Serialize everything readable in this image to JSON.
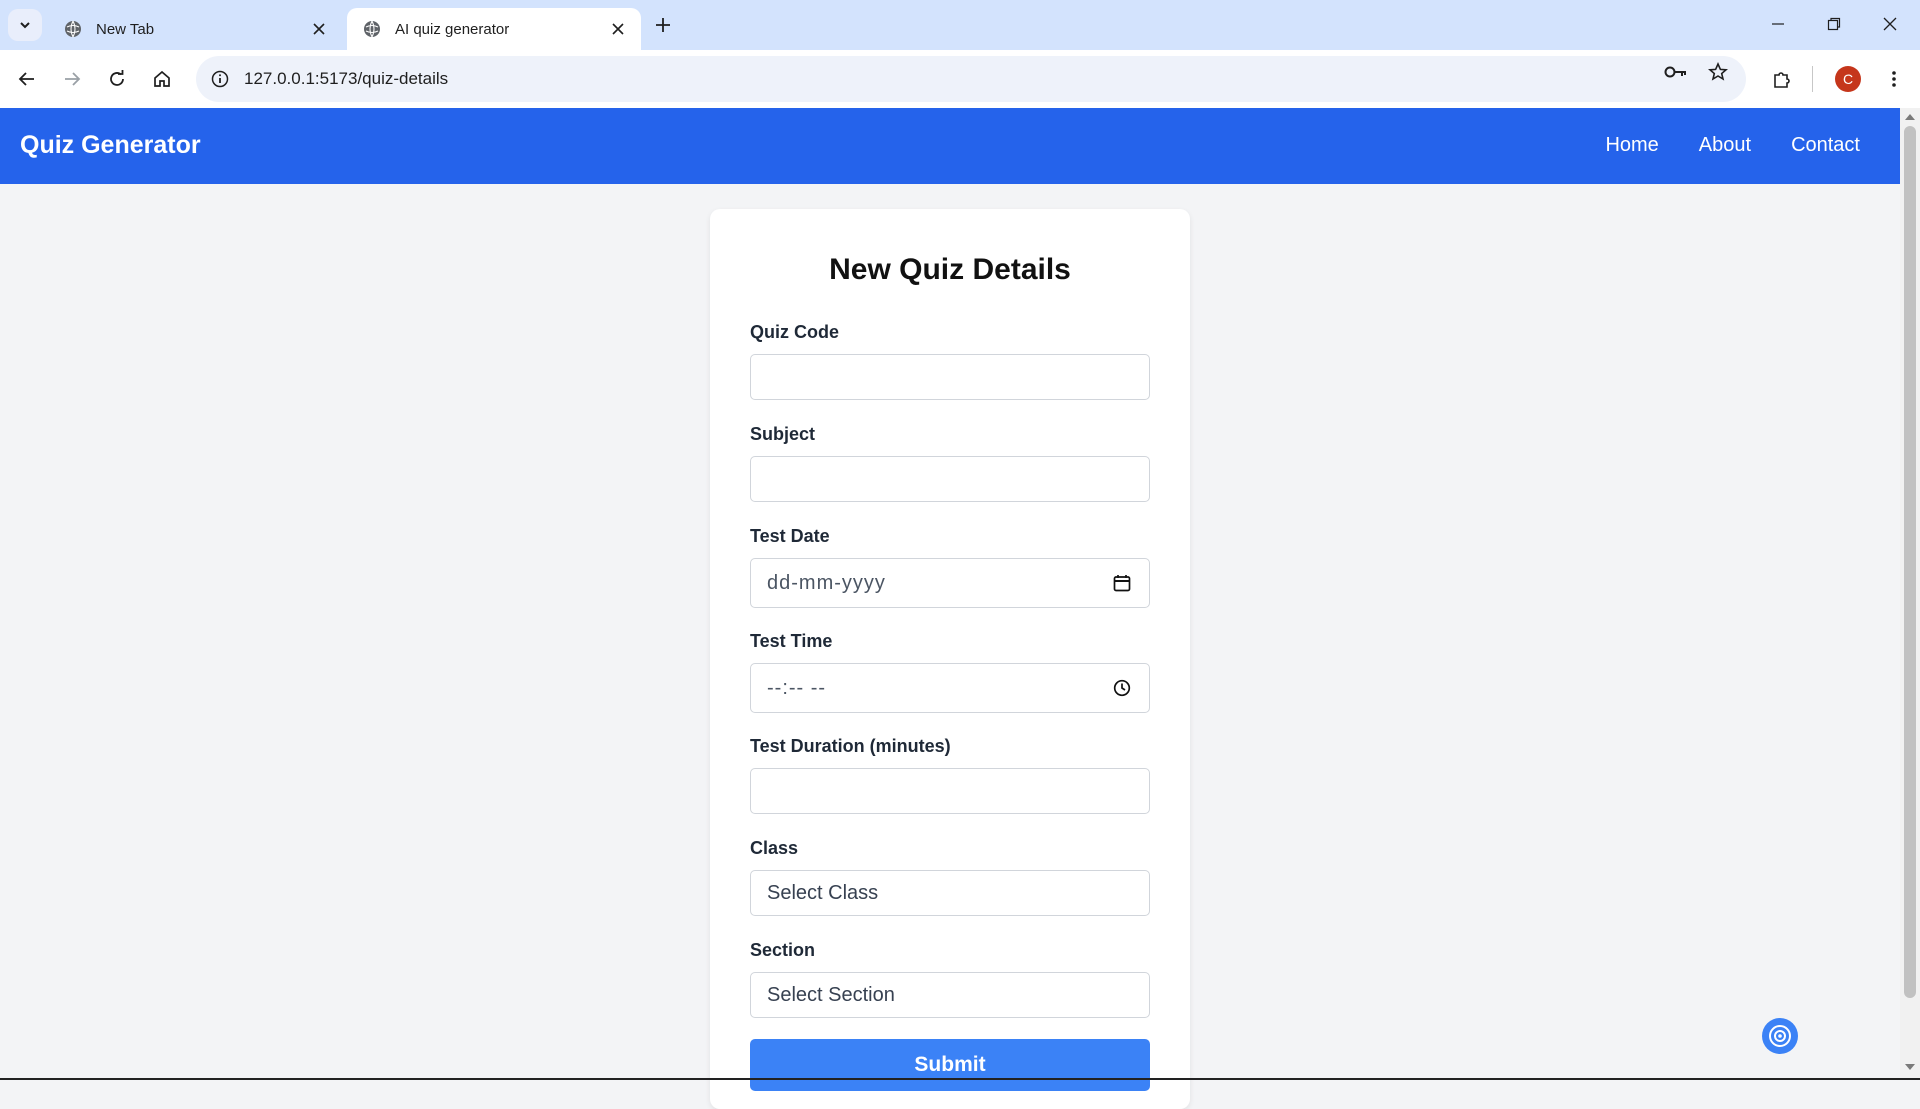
{
  "browser": {
    "tabs": [
      {
        "title": "New Tab"
      },
      {
        "title": "AI quiz generator"
      }
    ],
    "url": "127.0.0.1:5173/quiz-details",
    "profile_initial": "C"
  },
  "navbar": {
    "brand": "Quiz Generator",
    "links": [
      "Home",
      "About",
      "Contact"
    ],
    "color": "#2563eb"
  },
  "form": {
    "title": "New Quiz Details",
    "fields": [
      {
        "label": "Quiz Code",
        "value": ""
      },
      {
        "label": "Subject",
        "value": ""
      },
      {
        "label": "Test Date",
        "placeholder": "dd-mm-yyyy",
        "icon": "calendar-icon"
      },
      {
        "label": "Test Time",
        "placeholder": "--:-- --",
        "icon": "clock-icon"
      },
      {
        "label": "Test Duration (minutes)",
        "value": ""
      },
      {
        "label": "Class",
        "selected": "Select Class"
      },
      {
        "label": "Section",
        "selected": "Select Section"
      }
    ],
    "submit_label": "Submit",
    "submit_color": "#3b82f6"
  }
}
